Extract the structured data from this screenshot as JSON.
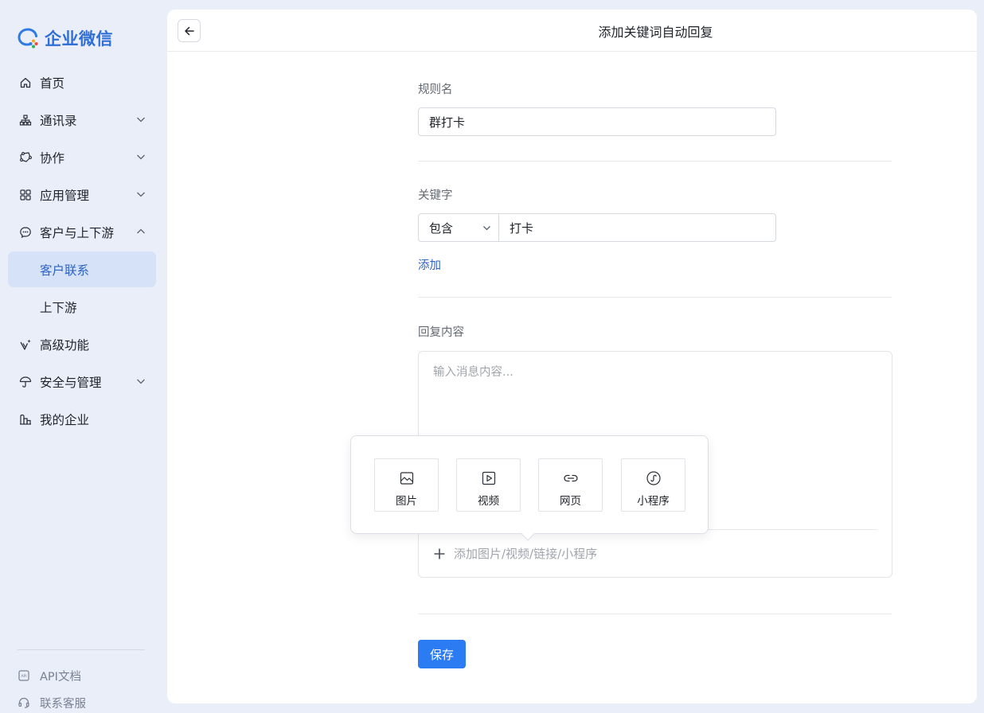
{
  "brand": {
    "name": "企业微信"
  },
  "sidebar": {
    "items": [
      {
        "label": "首页",
        "icon": "home-icon"
      },
      {
        "label": "通讯录",
        "icon": "org-chart-icon"
      },
      {
        "label": "协作",
        "icon": "collaboration-icon"
      },
      {
        "label": "应用管理",
        "icon": "apps-grid-icon"
      },
      {
        "label": "客户与上下游",
        "icon": "chat-bubble-icon"
      },
      {
        "label": "客户联系"
      },
      {
        "label": "上下游"
      },
      {
        "label": "高级功能",
        "icon": "sparkle-icon"
      },
      {
        "label": "安全与管理",
        "icon": "umbrella-icon"
      },
      {
        "label": "我的企业",
        "icon": "building-icon"
      }
    ],
    "footer": [
      {
        "label": "API文档",
        "icon": "api-doc-icon"
      },
      {
        "label": "联系客服",
        "icon": "headset-icon"
      }
    ]
  },
  "header": {
    "title": "添加关键词自动回复"
  },
  "form": {
    "rule_name_label": "规则名",
    "rule_name_value": "群打卡",
    "keyword_label": "关键字",
    "match_type": "包含",
    "keyword_value": "打卡",
    "add_label": "添加",
    "reply_label": "回复内容",
    "reply_placeholder": "输入消息内容...",
    "attach_label": "添加图片/视频/链接/小程序",
    "save_label": "保存"
  },
  "popover": {
    "options": [
      {
        "label": "图片",
        "icon": "image-icon"
      },
      {
        "label": "视频",
        "icon": "video-icon"
      },
      {
        "label": "网页",
        "icon": "link-icon"
      },
      {
        "label": "小程序",
        "icon": "mini-program-icon"
      }
    ]
  },
  "colors": {
    "accent": "#2b7cf2",
    "active_bg": "#d5e2f7",
    "active_text": "#2d63c6",
    "page_bg": "#e9eef9"
  }
}
